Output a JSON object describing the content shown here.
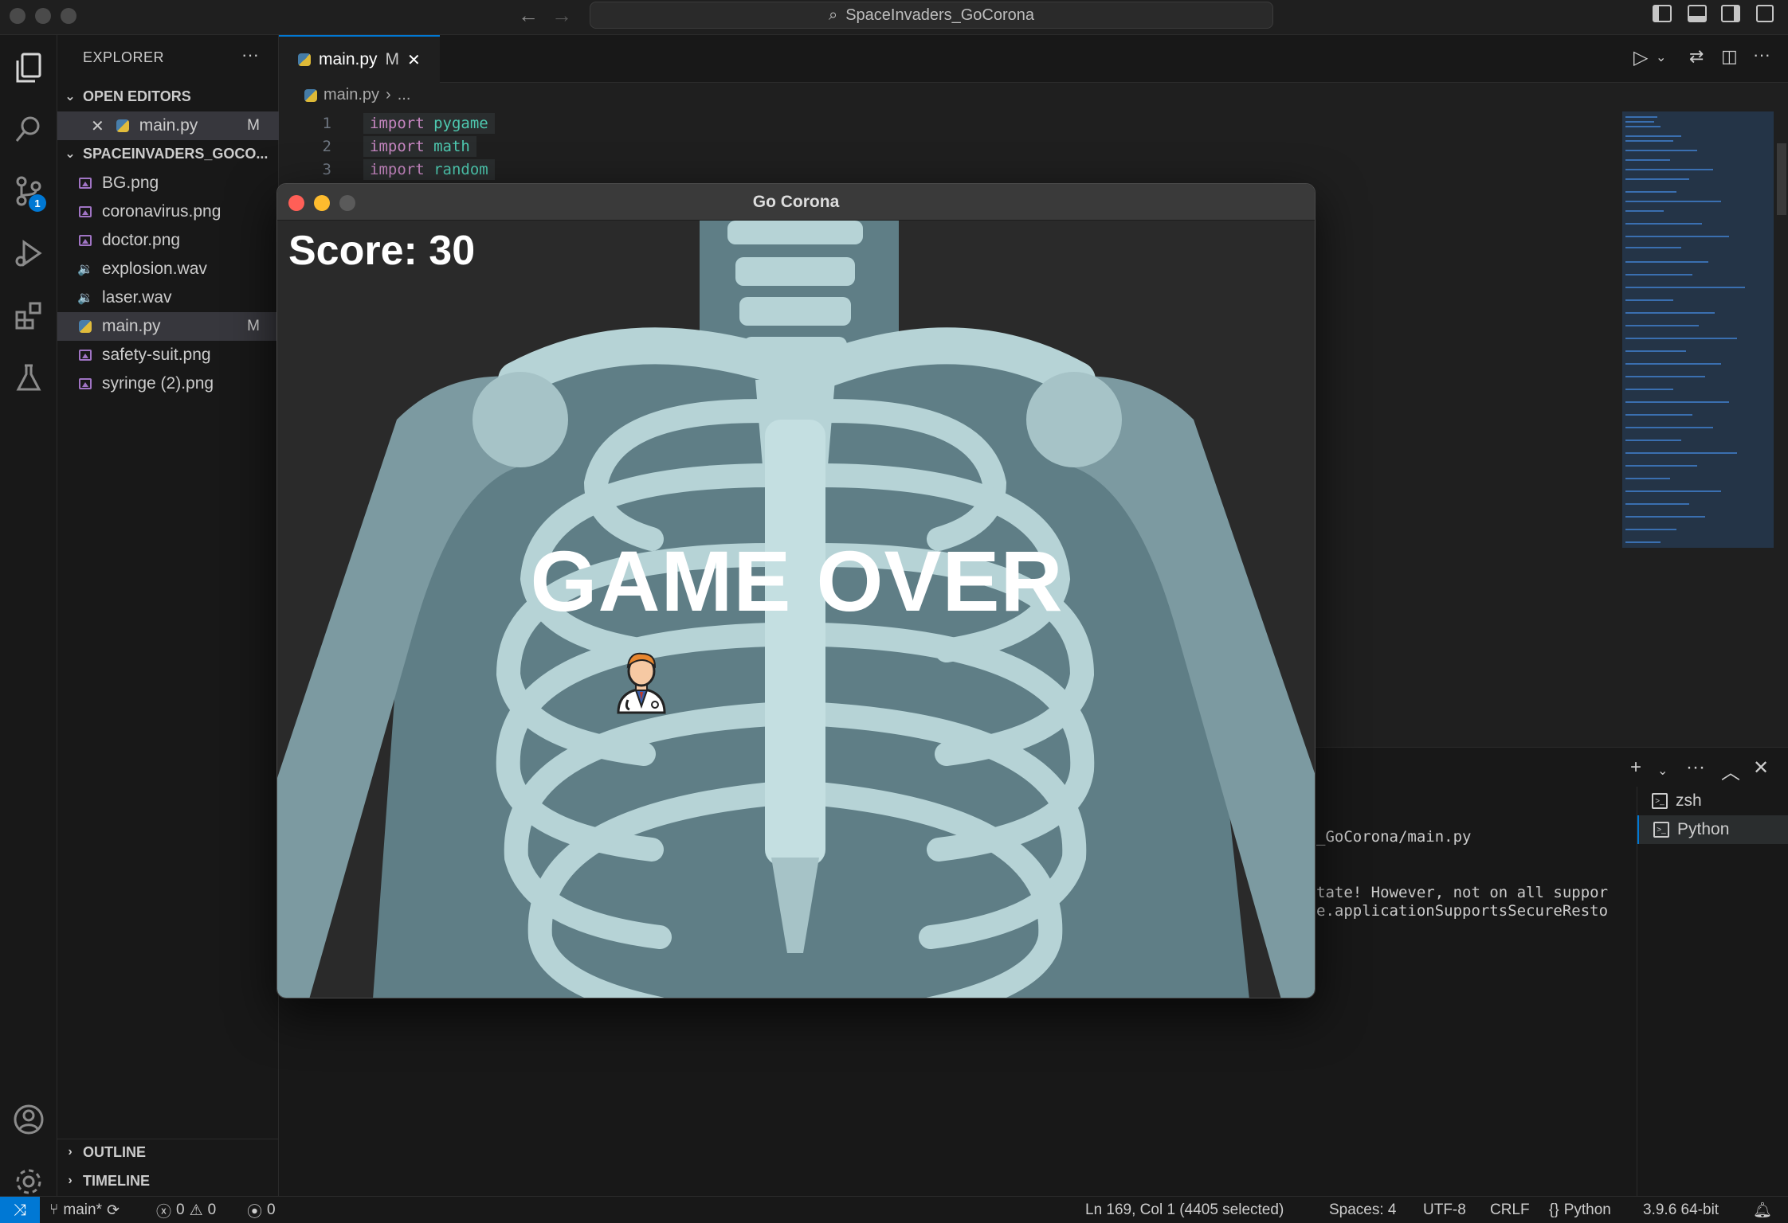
{
  "window": {
    "search_title": "SpaceInvaders_GoCorona"
  },
  "activity": {
    "scm_badge": "1"
  },
  "sidebar": {
    "title": "EXPLORER",
    "more": "···",
    "open_editors_label": "OPEN EDITORS",
    "open_editor": {
      "name": "main.py",
      "badge": "M"
    },
    "project_label": "SPACEINVADERS_GOCO...",
    "files": [
      {
        "name": "BG.png",
        "type": "image",
        "badge": ""
      },
      {
        "name": "coronavirus.png",
        "type": "image",
        "badge": ""
      },
      {
        "name": "doctor.png",
        "type": "image",
        "badge": ""
      },
      {
        "name": "explosion.wav",
        "type": "audio",
        "badge": ""
      },
      {
        "name": "laser.wav",
        "type": "audio",
        "badge": ""
      },
      {
        "name": "main.py",
        "type": "python",
        "badge": "M"
      },
      {
        "name": "safety-suit.png",
        "type": "image",
        "badge": ""
      },
      {
        "name": "syringe (2).png",
        "type": "image",
        "badge": ""
      }
    ],
    "outline_label": "OUTLINE",
    "timeline_label": "TIMELINE"
  },
  "editor": {
    "tab": {
      "name": "main.py",
      "badge": "M"
    },
    "breadcrumb": {
      "file": "main.py",
      "rest": "..."
    },
    "lines": [
      {
        "num": "1",
        "kw": "import",
        "mod": "pygame"
      },
      {
        "num": "2",
        "kw": "import",
        "mod": "math"
      },
      {
        "num": "3",
        "kw": "import",
        "mod": "random"
      }
    ]
  },
  "terminal": {
    "lines": [
      "_GoCorona/main.py",
      "tate! However, not on all suppor",
      "e.applicationSupportsSecureResto"
    ],
    "sessions": [
      "zsh",
      "Python"
    ]
  },
  "statusbar": {
    "branch": "main*",
    "errors": "0",
    "warnings": "0",
    "ports": "0",
    "position": "Ln 169, Col 1 (4405 selected)",
    "spaces": "Spaces: 4",
    "encoding": "UTF-8",
    "eol": "CRLF",
    "language": "Python",
    "interpreter": "3.9.6 64-bit"
  },
  "game": {
    "title": "Go Corona",
    "score": "Score: 30",
    "message": "GAME OVER"
  },
  "colors": {
    "accent": "#0078d4",
    "close": "#ff5f57",
    "minimize": "#febc2e",
    "xray_bone": "#b6d3d6",
    "xray_shadow": "#6f8e96"
  }
}
